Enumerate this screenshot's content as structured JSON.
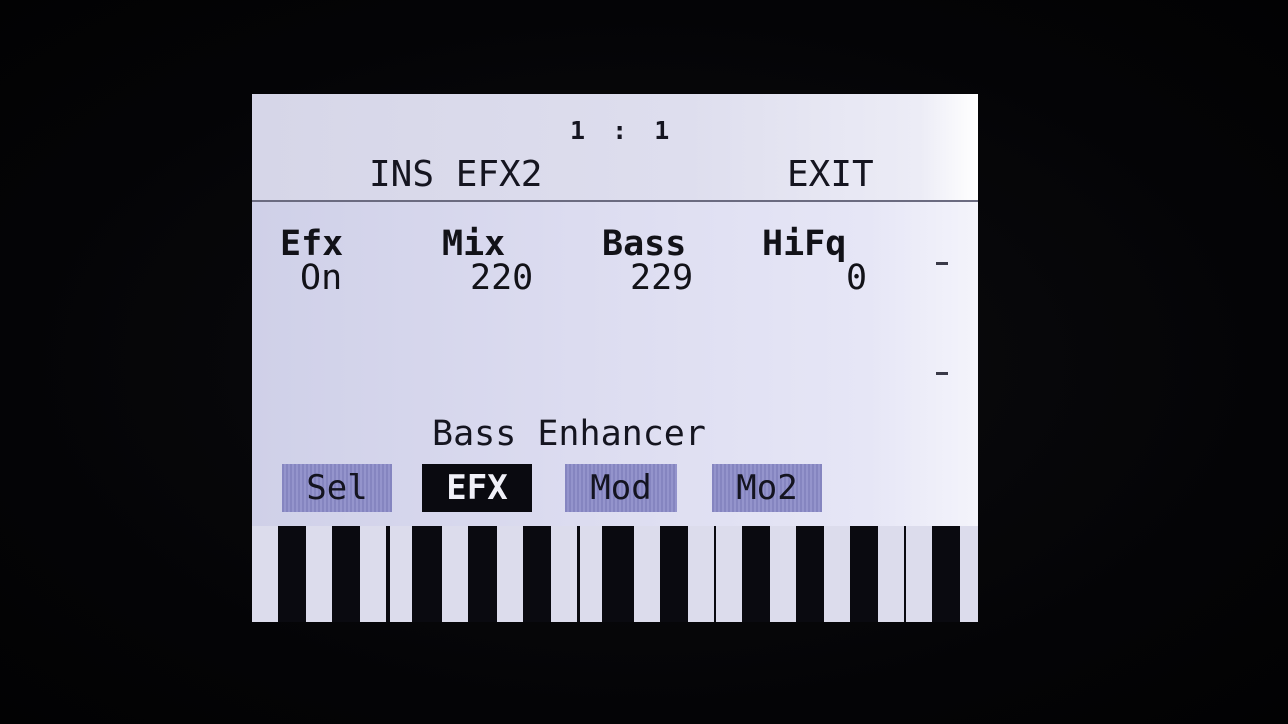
{
  "header": {
    "position": "1 : 1",
    "title": "INS EFX2",
    "exit_label": "EXIT"
  },
  "params": [
    {
      "name": "Efx",
      "value": "On"
    },
    {
      "name": "Mix",
      "value": "220"
    },
    {
      "name": "Bass",
      "value": "229"
    },
    {
      "name": "HiFq",
      "value": "0"
    }
  ],
  "effect_name": "Bass Enhancer",
  "tabs": [
    {
      "label": "Sel",
      "active": false
    },
    {
      "label": "EFX",
      "active": true
    },
    {
      "label": "Mod",
      "active": false
    },
    {
      "label": "Mo2",
      "active": false
    }
  ],
  "colors": {
    "screen_background": "#dcdcf0",
    "tab_inactive": "#8c8cc6",
    "tab_active": "#0a0a10",
    "text": "#151520"
  }
}
